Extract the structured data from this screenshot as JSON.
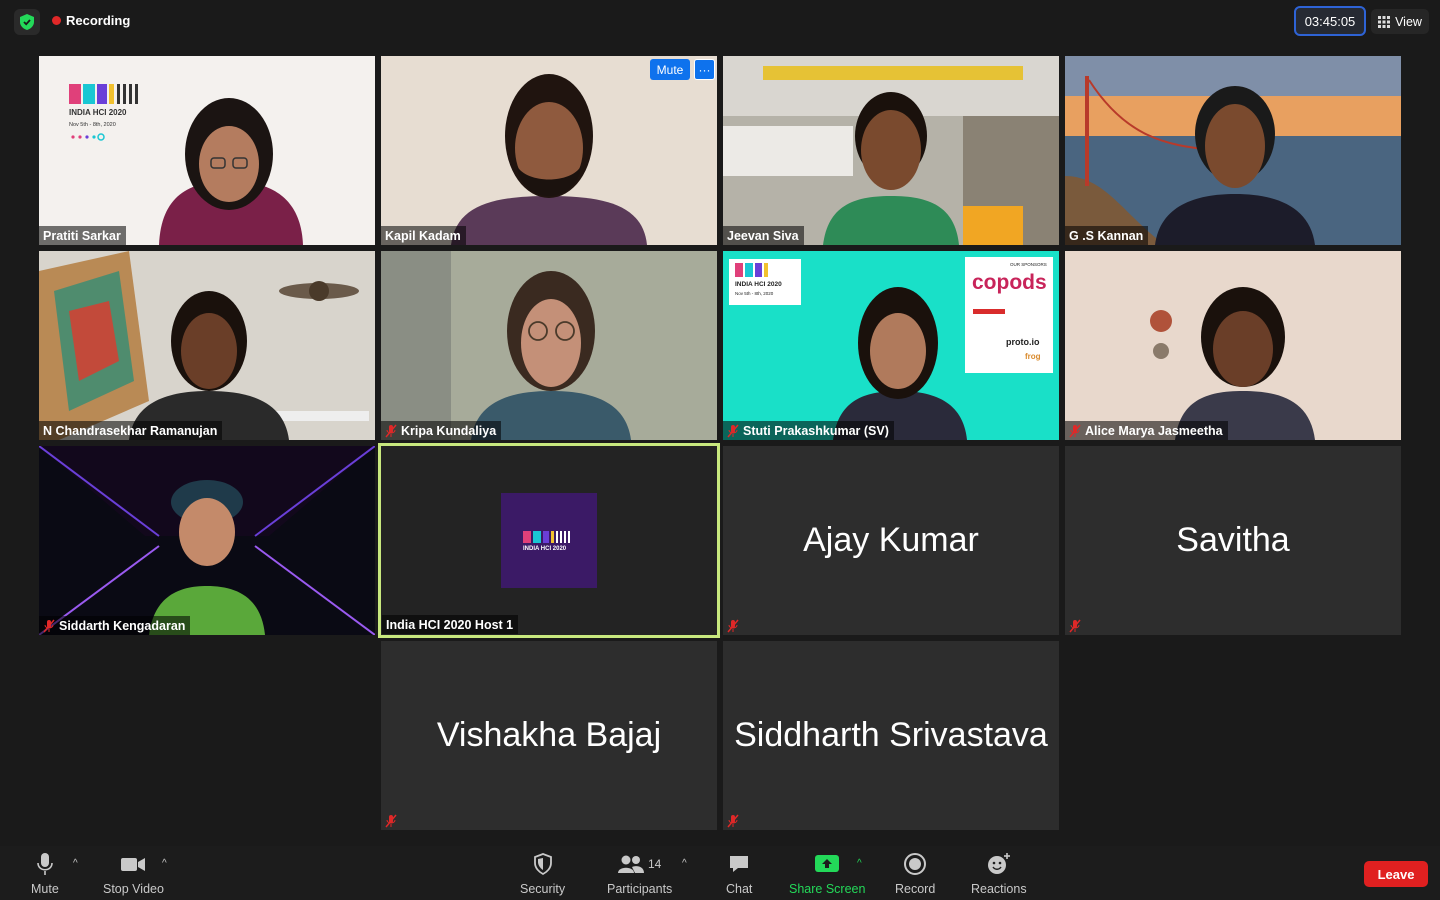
{
  "topbar": {
    "recording_label": "Recording",
    "timer": "03:45:05",
    "view_label": "View"
  },
  "tiles": [
    {
      "name": "Pratiti Sarkar",
      "type": "video",
      "muted": false
    },
    {
      "name": "Kapil Kadam",
      "type": "video",
      "muted": false
    },
    {
      "name": "Jeevan Siva",
      "type": "video",
      "muted": false
    },
    {
      "name": "G .S Kannan",
      "type": "video",
      "muted": false
    },
    {
      "name": "N Chandrasekhar Ramanujan",
      "type": "video",
      "muted": false
    },
    {
      "name": "Kripa Kundaliya",
      "type": "video",
      "muted": true
    },
    {
      "name": "Stuti Prakashkumar (SV)",
      "type": "video",
      "muted": true
    },
    {
      "name": "Alice Marya Jasmeetha",
      "type": "video",
      "muted": true
    },
    {
      "name": "Siddarth Kengadaran",
      "type": "video",
      "muted": true
    },
    {
      "name": "India HCI 2020 Host 1",
      "type": "logo",
      "muted": false
    },
    {
      "name": "Ajay Kumar",
      "type": "no-video",
      "muted": true
    },
    {
      "name": "Savitha",
      "type": "no-video",
      "muted": true
    },
    {
      "name": "Vishakha Bajaj",
      "type": "no-video",
      "muted": true
    },
    {
      "name": "Siddharth Srivastava",
      "type": "no-video",
      "muted": true
    }
  ],
  "tile_overlay": {
    "mute_label": "Mute",
    "more_label": "···"
  },
  "banners": {
    "event_name": "INDIA HCI 2020",
    "event_dates": "Nov 5th - 8th, 2020",
    "sponsor_heading": "OUR SPONSORS",
    "sponsor_main": "copods",
    "sponsor_proto": "proto.io",
    "sponsor_frog": "frog"
  },
  "toolbar": {
    "mute_label": "Mute",
    "stop_video_label": "Stop Video",
    "security_label": "Security",
    "participants_label": "Participants",
    "participants_count": "14",
    "chat_label": "Chat",
    "share_screen_label": "Share Screen",
    "record_label": "Record",
    "reactions_label": "Reactions",
    "leave_label": "Leave"
  },
  "colors": {
    "accent_blue": "#0e72ed",
    "leave_red": "#e02020",
    "share_green": "#23d959",
    "host_border": "#c8e87e",
    "tile_bg": "#2d2d2d"
  }
}
